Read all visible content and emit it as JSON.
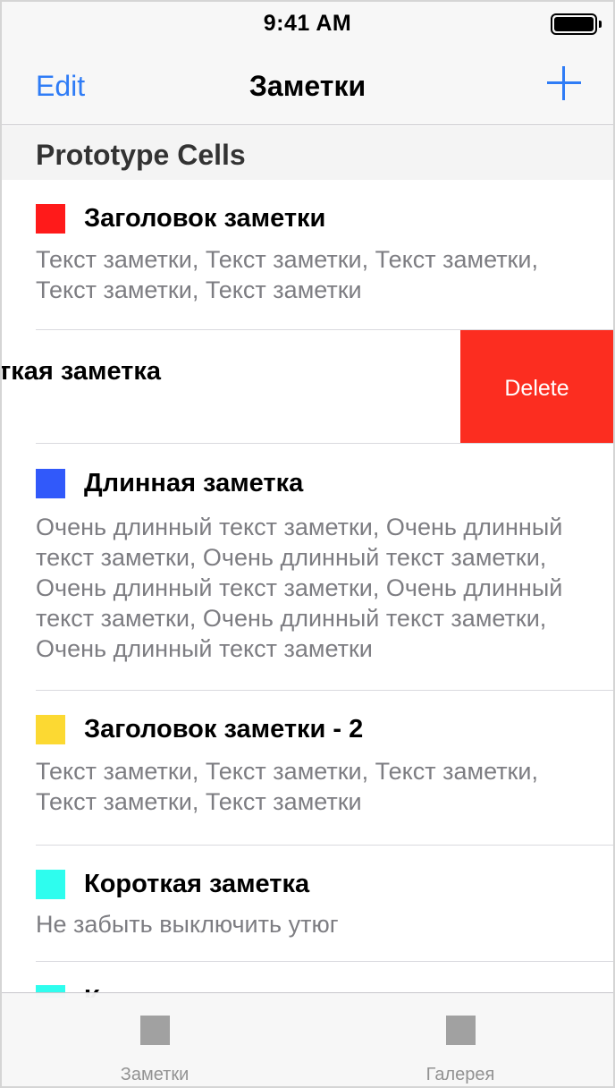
{
  "status_bar": {
    "time": "9:41 AM"
  },
  "nav": {
    "edit_label": "Edit",
    "title": "Заметки",
    "add_icon": "plus-icon"
  },
  "section": {
    "title": "Prototype Cells"
  },
  "notes": [
    {
      "color": "#ff1a1a",
      "title": "Заголовок заметки",
      "text": "Текст заметки, Текст заметки, Текст заметки, Текст заметки, Текст заметки"
    },
    {
      "title": "ткая заметка",
      "delete_label": "Delete",
      "delete_color": "#fc2d20"
    },
    {
      "color": "#3159fa",
      "title": "Длинная заметка",
      "text": "Очень длинный текст заметки, Очень длинный текст заметки, Очень длинный текст заметки, Очень длинный текст заметки, Очень длинный текст заметки, Очень длинный текст заметки, Очень длинный текст заметки"
    },
    {
      "color": "#fcd932",
      "title": "Заголовок заметки - 2",
      "text": "Текст заметки, Текст заметки, Текст заметки, Текст заметки, Текст заметки"
    },
    {
      "color": "#2efdee",
      "title": "Короткая заметка",
      "text": "Не забыть выключить утюг"
    },
    {
      "color": "#2efdee",
      "title": "К"
    }
  ],
  "tab_bar": {
    "tabs": [
      {
        "label": "Заметки",
        "icon": "square-icon"
      },
      {
        "label": "Галерея",
        "icon": "square-icon"
      }
    ]
  },
  "colors": {
    "accent": "#2f7cf6",
    "destructive": "#fc2d20"
  }
}
